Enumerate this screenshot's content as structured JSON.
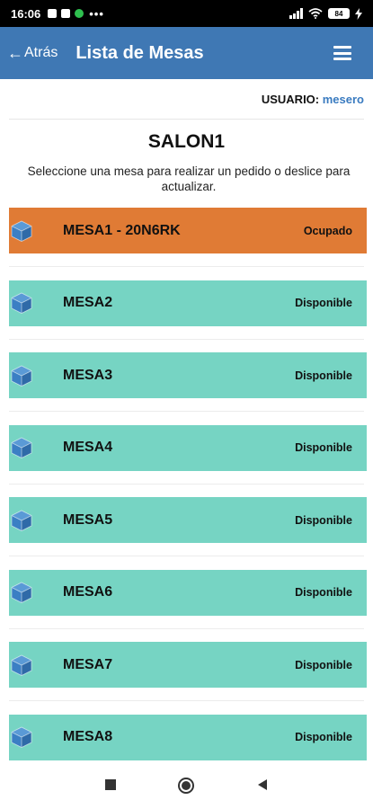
{
  "status_bar": {
    "time": "16:06",
    "battery": "84"
  },
  "header": {
    "back_label": "Atrás",
    "title": "Lista de Mesas",
    "menu_icon": "hamburger-menu-icon"
  },
  "user": {
    "label": "USUARIO:",
    "name": "mesero"
  },
  "salon": {
    "name": "SALON1",
    "instructions": "Seleccione una mesa para realizar un pedido o deslice para actualizar."
  },
  "colors": {
    "header": "#3f78b4",
    "occupied": "#e07b35",
    "available": "#76d4c3",
    "user_name": "#3a7bc0",
    "icon": "#3b7fc4"
  },
  "tables": [
    {
      "name": "MESA1 - 20N6RK",
      "status": "Ocupado",
      "state": "ocupado"
    },
    {
      "name": "MESA2",
      "status": "Disponible",
      "state": "libre"
    },
    {
      "name": "MESA3",
      "status": "Disponible",
      "state": "libre"
    },
    {
      "name": "MESA4",
      "status": "Disponible",
      "state": "libre"
    },
    {
      "name": "MESA5",
      "status": "Disponible",
      "state": "libre"
    },
    {
      "name": "MESA6",
      "status": "Disponible",
      "state": "libre"
    },
    {
      "name": "MESA7",
      "status": "Disponible",
      "state": "libre"
    },
    {
      "name": "MESA8",
      "status": "Disponible",
      "state": "libre"
    }
  ],
  "nav": {
    "icons": [
      "recents-square-icon",
      "home-circle-icon",
      "back-triangle-icon"
    ]
  }
}
